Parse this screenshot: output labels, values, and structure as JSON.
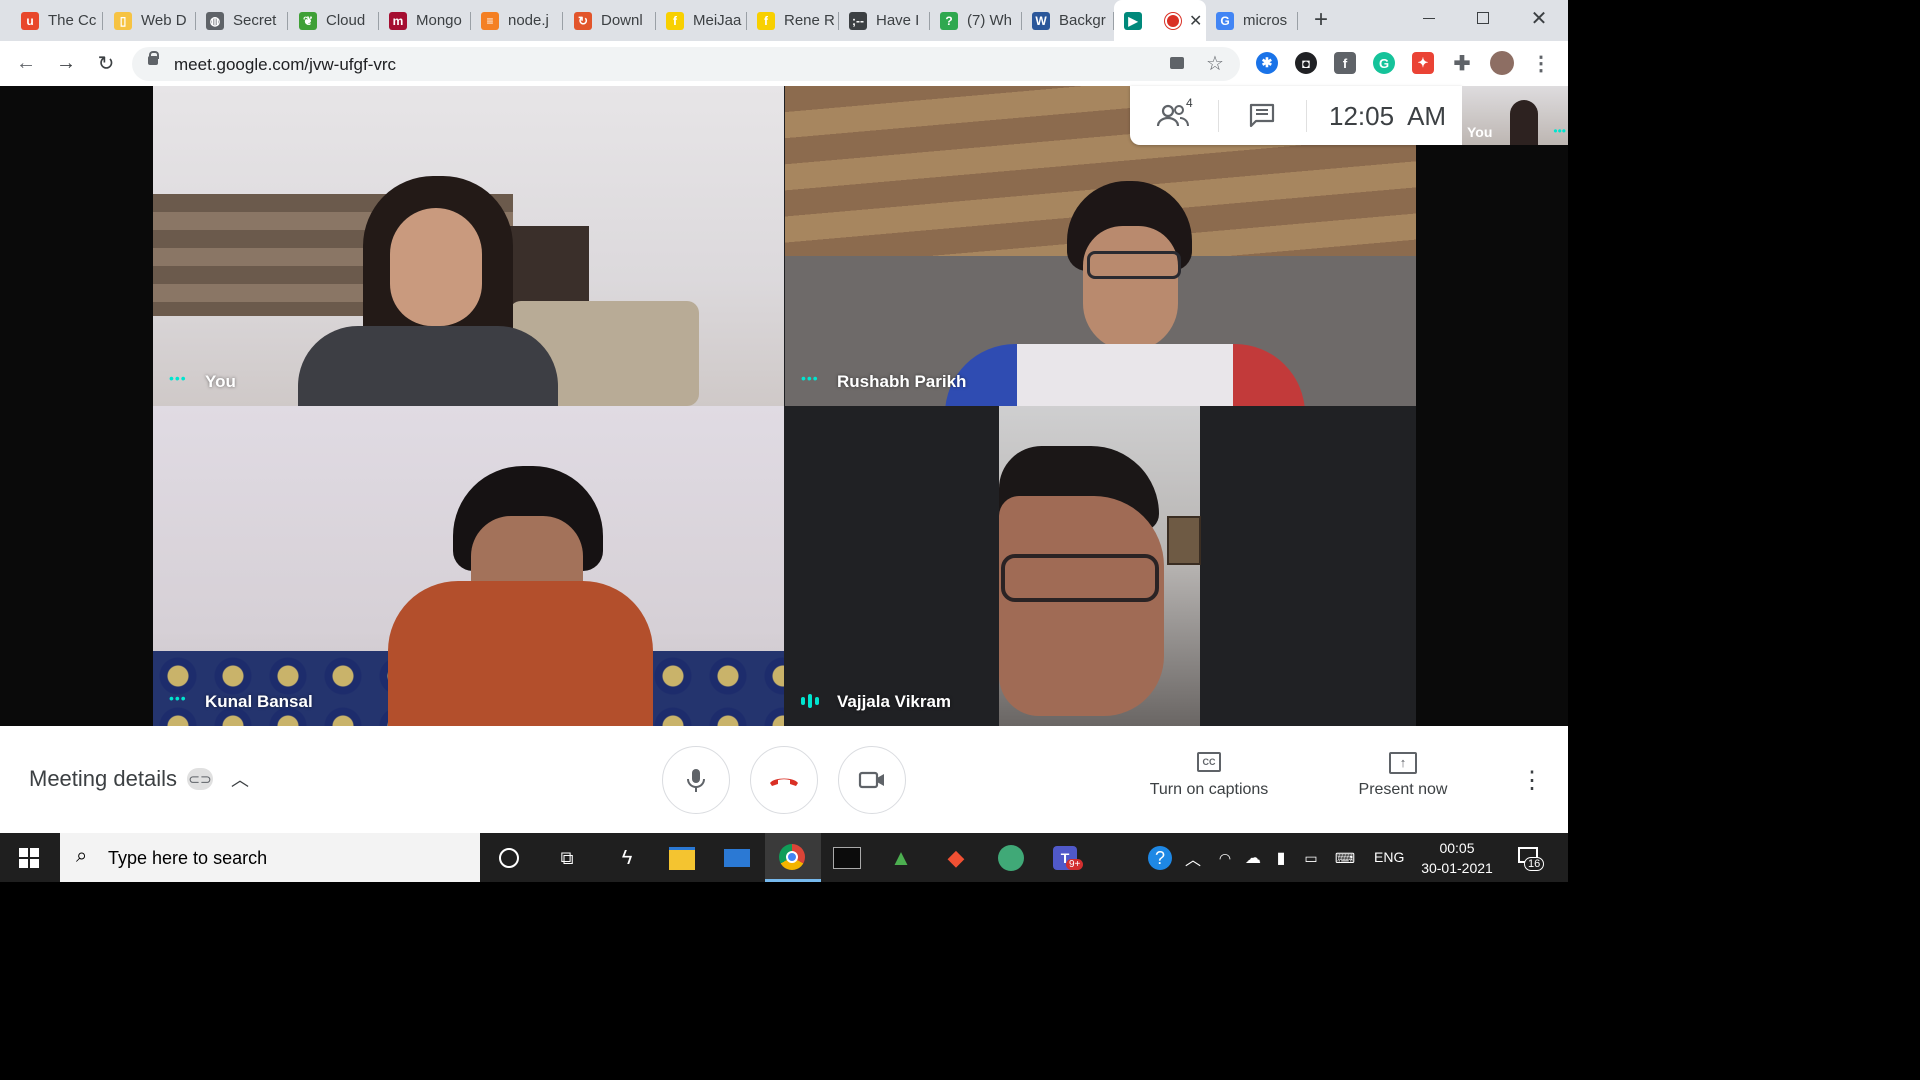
{
  "browser": {
    "tabs": [
      {
        "label": "The Cc",
        "fav_color": "#e8472b",
        "fav_glyph": "u"
      },
      {
        "label": "Web D",
        "fav_color": "#f6c343",
        "fav_glyph": "▯"
      },
      {
        "label": "Secret",
        "fav_color": "#5f6368",
        "fav_glyph": "◍"
      },
      {
        "label": "Cloud",
        "fav_color": "#3fa037",
        "fav_glyph": "❦"
      },
      {
        "label": "Mongo",
        "fav_color": "#a50e31",
        "fav_glyph": "m"
      },
      {
        "label": "node.j",
        "fav_color": "#f48024",
        "fav_glyph": "≡"
      },
      {
        "label": "Downl",
        "fav_color": "#e2552b",
        "fav_glyph": "↻"
      },
      {
        "label": "MeiJaa",
        "fav_color": "#f8d000",
        "fav_glyph": "f"
      },
      {
        "label": "Rene R",
        "fav_color": "#f8d000",
        "fav_glyph": "f"
      },
      {
        "label": "Have I",
        "fav_color": "#3c4043",
        "fav_glyph": ";--"
      },
      {
        "label": "(7) Wh",
        "fav_color": "#2fa84f",
        "fav_glyph": "?"
      },
      {
        "label": "Backgr",
        "fav_color": "#2b579a",
        "fav_glyph": "W"
      },
      {
        "label": "",
        "fav_color": "#00897b",
        "fav_glyph": "▶"
      },
      {
        "label": "micros",
        "fav_color": "#4285f4",
        "fav_glyph": "G"
      }
    ],
    "new_tab": "+",
    "url": "meet.google.com/jvw-ufgf-vrc"
  },
  "meet": {
    "participant_count": "4",
    "time": "12:05  AM",
    "self_thumb_label": "You",
    "tiles": [
      {
        "name": "You"
      },
      {
        "name": "Rushabh Parikh"
      },
      {
        "name": "Kunal Bansal"
      },
      {
        "name": "Vajjala Vikram"
      }
    ],
    "meeting_details": "Meeting details",
    "captions_label": "Turn on captions",
    "present_label": "Present now"
  },
  "taskbar": {
    "search_placeholder": "Type here to search",
    "lang": "ENG",
    "clock_time": "00:05",
    "clock_date": "30-01-2021",
    "notif_count": "16",
    "teams_badge": "9+"
  }
}
